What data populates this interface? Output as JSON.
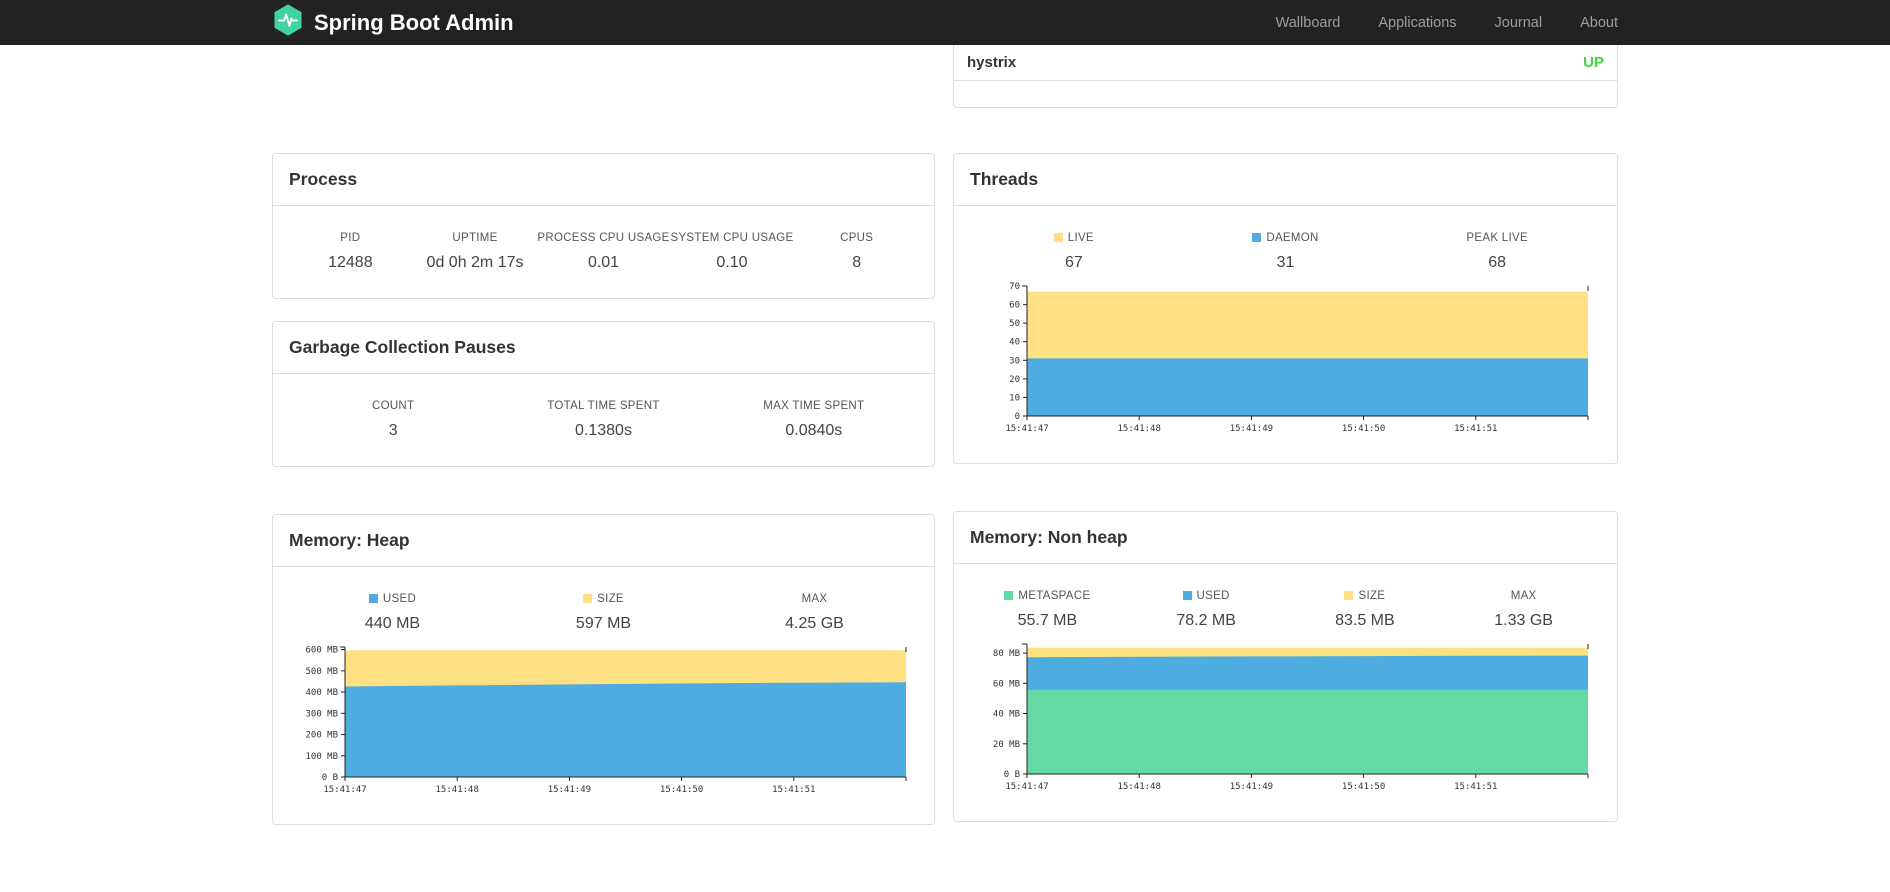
{
  "navbar": {
    "brand": "Spring Boot Admin",
    "links": [
      "Wallboard",
      "Applications",
      "Journal",
      "About"
    ]
  },
  "health": {
    "rows": [
      {
        "name": "hystrix",
        "status": "UP"
      }
    ],
    "status_up_color": "#47d147"
  },
  "colors": {
    "yellow": "#ffe083",
    "blue": "#4face0",
    "green": "#63d9a6",
    "navbar_bg": "#222222",
    "logo_teal": "#42d3a5"
  },
  "panels": {
    "process": {
      "title": "Process",
      "metrics": [
        {
          "label": "PID",
          "value": "12488"
        },
        {
          "label": "UPTIME",
          "value": "0d 0h 2m 17s"
        },
        {
          "label": "PROCESS CPU USAGE",
          "value": "0.01"
        },
        {
          "label": "SYSTEM CPU USAGE",
          "value": "0.10"
        },
        {
          "label": "CPUS",
          "value": "8"
        }
      ]
    },
    "gc": {
      "title": "Garbage Collection Pauses",
      "metrics": [
        {
          "label": "COUNT",
          "value": "3"
        },
        {
          "label": "TOTAL TIME SPENT",
          "value": "0.1380s"
        },
        {
          "label": "MAX TIME SPENT",
          "value": "0.0840s"
        }
      ]
    },
    "threads": {
      "title": "Threads",
      "legend": [
        {
          "label": "LIVE",
          "value": "67",
          "color": "#ffe083"
        },
        {
          "label": "DAEMON",
          "value": "31",
          "color": "#4face0"
        },
        {
          "label": "PEAK LIVE",
          "value": "68"
        }
      ]
    },
    "heap": {
      "title": "Memory: Heap",
      "legend": [
        {
          "label": "USED",
          "value": "440 MB",
          "color": "#4face0"
        },
        {
          "label": "SIZE",
          "value": "597 MB",
          "color": "#ffe083"
        },
        {
          "label": "MAX",
          "value": "4.25 GB"
        }
      ]
    },
    "nonheap": {
      "title": "Memory: Non heap",
      "legend": [
        {
          "label": "METASPACE",
          "value": "55.7 MB",
          "color": "#63d9a6"
        },
        {
          "label": "USED",
          "value": "78.2 MB",
          "color": "#4face0"
        },
        {
          "label": "SIZE",
          "value": "83.5 MB",
          "color": "#ffe083"
        },
        {
          "label": "MAX",
          "value": "1.33 GB"
        }
      ]
    }
  },
  "chart_data": [
    {
      "id": "threads",
      "type": "area",
      "title": "Threads",
      "x": [
        "15:41:47",
        "15:41:48",
        "15:41:49",
        "15:41:50",
        "15:41:51"
      ],
      "series": [
        {
          "name": "LIVE",
          "color": "#ffe083",
          "values": [
            67,
            67,
            67,
            67,
            67,
            67
          ]
        },
        {
          "name": "DAEMON",
          "color": "#4face0",
          "values": [
            31,
            31,
            31,
            31,
            31,
            31
          ]
        }
      ],
      "ylim": [
        0,
        70
      ],
      "yticks": [
        {
          "v": 0,
          "label": "0"
        },
        {
          "v": 10,
          "label": "10"
        },
        {
          "v": 20,
          "label": "20"
        },
        {
          "v": 30,
          "label": "30"
        },
        {
          "v": 40,
          "label": "40"
        },
        {
          "v": 50,
          "label": "50"
        },
        {
          "v": 60,
          "label": "60"
        },
        {
          "v": 70,
          "label": "70"
        }
      ],
      "legend_position": "top",
      "grid": false,
      "xlabel": "",
      "ylabel": ""
    },
    {
      "id": "memory-heap",
      "type": "area",
      "title": "Memory: Heap",
      "x": [
        "15:41:47",
        "15:41:48",
        "15:41:49",
        "15:41:50",
        "15:41:51"
      ],
      "series": [
        {
          "name": "SIZE",
          "color": "#ffe083",
          "values": [
            597,
            597,
            597,
            597,
            597,
            597
          ]
        },
        {
          "name": "USED",
          "color": "#4face0",
          "values": [
            426,
            431,
            436,
            440,
            444,
            446
          ]
        }
      ],
      "ylim": [
        0,
        612
      ],
      "yticks": [
        {
          "v": 0,
          "label": "0 B"
        },
        {
          "v": 100,
          "label": "100 MB"
        },
        {
          "v": 200,
          "label": "200 MB"
        },
        {
          "v": 300,
          "label": "300 MB"
        },
        {
          "v": 400,
          "label": "400 MB"
        },
        {
          "v": 500,
          "label": "500 MB"
        },
        {
          "v": 600,
          "label": "600 MB"
        }
      ],
      "legend_position": "top",
      "grid": false,
      "xlabel": "",
      "ylabel": ""
    },
    {
      "id": "memory-nonheap",
      "type": "area",
      "title": "Memory: Non heap",
      "x": [
        "15:41:47",
        "15:41:48",
        "15:41:49",
        "15:41:50",
        "15:41:51"
      ],
      "series": [
        {
          "name": "SIZE",
          "color": "#ffe083",
          "values": [
            83.5,
            83.5,
            83.5,
            83.5,
            83.5,
            83.5
          ]
        },
        {
          "name": "USED",
          "color": "#4face0",
          "values": [
            77.2,
            77.5,
            77.8,
            78.0,
            78.2,
            78.3
          ]
        },
        {
          "name": "METASPACE",
          "color": "#63d9a6",
          "values": [
            55.7,
            55.7,
            55.7,
            55.7,
            55.7,
            55.7
          ]
        }
      ],
      "ylim": [
        0,
        86
      ],
      "yticks": [
        {
          "v": 0,
          "label": "0 B"
        },
        {
          "v": 20,
          "label": "20 MB"
        },
        {
          "v": 40,
          "label": "40 MB"
        },
        {
          "v": 60,
          "label": "60 MB"
        },
        {
          "v": 80,
          "label": "80 MB"
        }
      ],
      "legend_position": "top",
      "grid": false,
      "xlabel": "",
      "ylabel": ""
    }
  ]
}
